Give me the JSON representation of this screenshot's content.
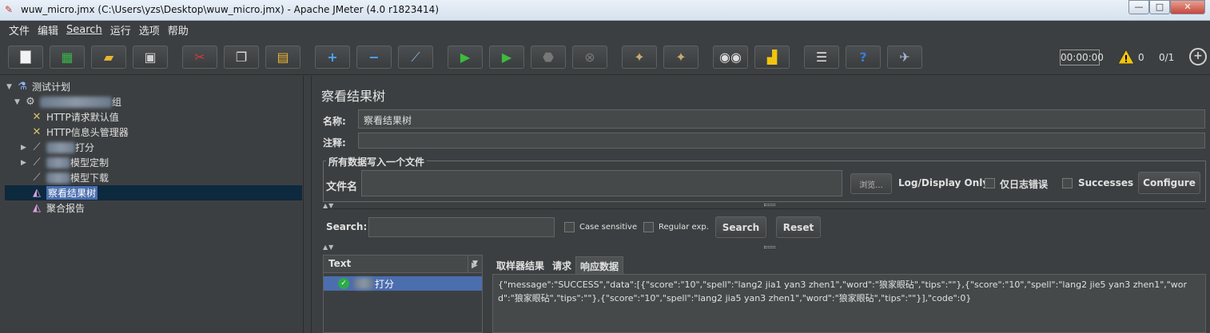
{
  "window": {
    "title": "wuw_micro.jmx (C:\\Users\\yzs\\Desktop\\wuw_micro.jmx) - Apache JMeter (4.0 r1823414)",
    "minimize": "—",
    "maximize": "□",
    "close": "✕"
  },
  "menu": {
    "items": [
      "文件",
      "编辑",
      "Search",
      "运行",
      "选项",
      "帮助"
    ]
  },
  "toolbar": {
    "timer": "00:00:00",
    "warning_count": "0",
    "threads": "0/1",
    "icons": [
      "new-icon",
      "templates-icon",
      "open-icon",
      "save-icon",
      "cut-icon",
      "copy-icon",
      "paste-icon",
      "expand-icon",
      "collapse-icon",
      "toggle-icon",
      "start-icon",
      "start-no-pause-icon",
      "stop-icon",
      "shutdown-icon",
      "clear-icon",
      "clear-all-icon",
      "search-icon",
      "reset-search-icon",
      "function-helper-icon",
      "help-icon",
      "remote-icon"
    ]
  },
  "tree": {
    "root": "测试计划",
    "thread_group_suffix": "组",
    "items": [
      {
        "label": "HTTP请求默认值"
      },
      {
        "label": "HTTP信息头管理器"
      },
      {
        "label": "打分"
      },
      {
        "label": "模型定制"
      },
      {
        "label": "模型下载"
      },
      {
        "label": "察看结果树"
      },
      {
        "label": "聚合报告"
      }
    ]
  },
  "panel": {
    "title": "察看结果树",
    "name_label": "名称:",
    "name_value": "察看结果树",
    "comment_label": "注释:",
    "comment_value": "",
    "file_section_legend": "所有数据写入一个文件",
    "file_label": "文件名",
    "file_value": "",
    "browse_label": "浏览...",
    "log_display_label": "Log/Display Only:",
    "errors_only_label": "仅日志错误",
    "successes_label": "Successes",
    "configure_label": "Configure"
  },
  "search": {
    "label": "Search:",
    "value": "",
    "case_sensitive_label": "Case sensitive",
    "regex_label": "Regular exp.",
    "search_button": "Search",
    "reset_button": "Reset"
  },
  "results": {
    "renderer": "Text",
    "sample_label": "打分",
    "tabs": [
      "取样器结果",
      "请求",
      "响应数据"
    ],
    "active_tab_index": 2,
    "response_text": "{\"message\":\"SUCCESS\",\"data\":[{\"score\":\"10\",\"spell\":\"lang2 jia1 yan3 zhen1\",\"word\":\"狼家眼砧\",\"tips\":\"\"},{\"score\":\"10\",\"spell\":\"lang2 jie5 yan3 zhen1\",\"word\":\"狼家眼砧\",\"tips\":\"\"},{\"score\":\"10\",\"spell\":\"lang2 jia5 yan3 zhen1\",\"word\":\"狼家眼砧\",\"tips\":\"\"}],\"code\":0}"
  },
  "colors": {
    "background": "#3c3f41",
    "selection": "#4b6eaf",
    "success": "#2eaa49",
    "start_green": "#3dbb3d"
  }
}
